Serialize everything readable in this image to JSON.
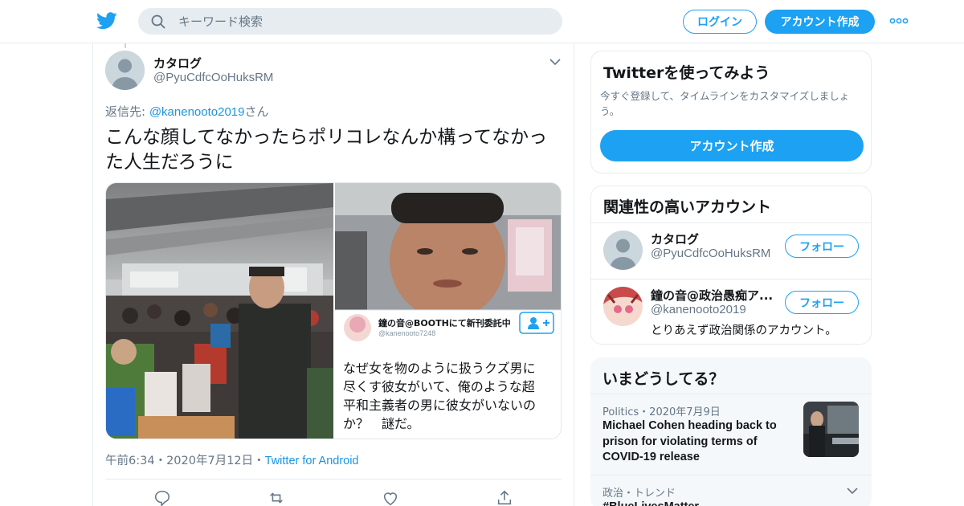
{
  "header": {
    "search_placeholder": "キーワード検索",
    "login_label": "ログイン",
    "signup_label": "アカウント作成",
    "brand_color": "#1da1f2"
  },
  "tweet": {
    "author_name": "カタログ",
    "author_handle": "@PyuCdfcOoHuksRM",
    "reply_prefix": "返信先: ",
    "reply_handle": "@kanenooto2019",
    "reply_suffix": "さん",
    "text": "こんな顔してなかったらポリコレなんか構ってなかった人生だろうに",
    "embedded": {
      "name": "鐘の音@BOOTHにて新刊委託中",
      "handle": "@kanenooto7248",
      "text_line1": "なぜ女を物のように扱うクズ男に",
      "text_line2": "尽くす彼女がいて、俺のような超",
      "text_line3": "平和主義者の男に彼女がいないの",
      "text_line4": "か？　謎だ。"
    },
    "time": "午前6:34",
    "date": "2020年7月12日",
    "source": "Twitter for Android",
    "dot": "・"
  },
  "sidebar": {
    "try_card": {
      "title": "Twitterを使ってみよう",
      "desc": "今すぐ登録して、タイムラインをカスタマイズしましょう。",
      "cta": "アカウント作成"
    },
    "related": {
      "title": "関連性の高いアカウント",
      "follow_label": "フォロー",
      "accounts": [
        {
          "name": "カタログ",
          "handle": "@PyuCdfcOoHuksRM",
          "bio": ""
        },
        {
          "name": "鐘の音@政治愚痴ア...",
          "handle": "@kanenooto2019",
          "bio": "とりあえず政治関係のアカウント。"
        }
      ]
    },
    "trends": {
      "title": "いまどうしてる？",
      "items": [
        {
          "meta": "Politics・2020年7月9日",
          "title": "Michael Cohen heading back to prison for violating terms of COVID-19 release"
        },
        {
          "meta": "政治・トレンド",
          "title": "#BlueLivesMatter"
        }
      ]
    }
  }
}
